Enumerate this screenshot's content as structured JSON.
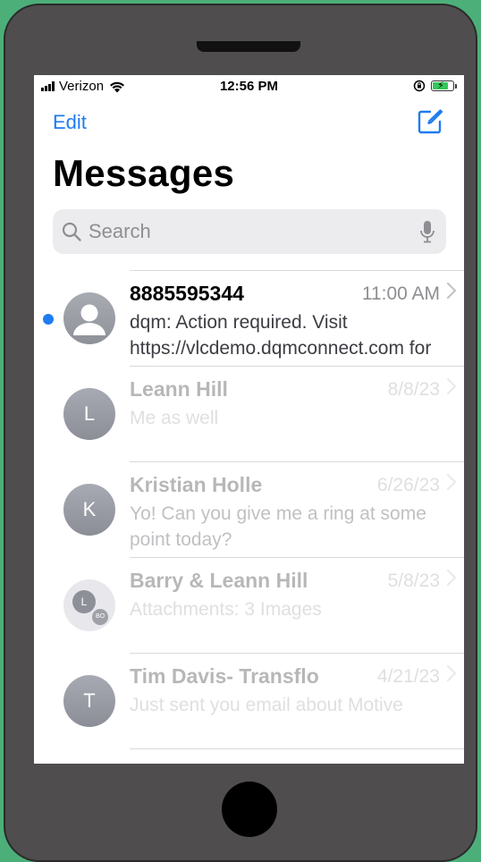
{
  "status_bar": {
    "carrier": "Verizon",
    "time": "12:56 PM",
    "battery_color": "#34c759"
  },
  "nav": {
    "edit_label": "Edit",
    "compose_icon": "compose-icon",
    "title": "Messages"
  },
  "search": {
    "placeholder": "Search",
    "icon": "search-icon",
    "mic_icon": "mic-icon"
  },
  "conversations": [
    {
      "name": "8885595344",
      "date": "11:00 AM",
      "sender": "dqm",
      "preview": ": Action required. Visit https://vlcdemo.dqmconnect.com for det...",
      "avatar": "person-icon",
      "unread": true
    },
    {
      "name": "Leann Hill",
      "date": "8/8/23",
      "preview": "Me as well",
      "avatar_initial": "L"
    },
    {
      "name": "Kristian Holle",
      "date": "6/26/23",
      "preview": "Yo! Can you give me a ring at some point today?",
      "avatar_initial": "K"
    },
    {
      "name": "Barry & Leann Hill",
      "date": "5/8/23",
      "preview": "Attachments: 3 Images",
      "avatar_initials": [
        "L",
        "BO"
      ]
    },
    {
      "name": "Tim Davis- Transflo",
      "date": "4/21/23",
      "preview": "Just sent you email about Motive",
      "avatar_initial": "T"
    }
  ],
  "colors": {
    "accent": "#1f7cf0",
    "background": "#4caf7a",
    "phone_body": "#4f4d4e"
  }
}
